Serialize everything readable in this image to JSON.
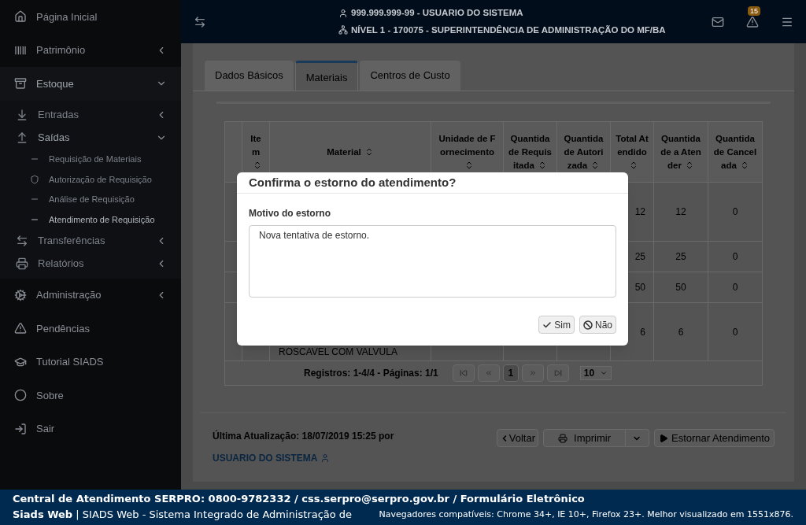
{
  "sidebar": {
    "items": [
      {
        "label": "Página Inicial",
        "kind": "link"
      },
      {
        "label": "Patrimônio",
        "kind": "group",
        "expanded": false
      },
      {
        "label": "Estoque",
        "kind": "group",
        "expanded": true,
        "children": [
          {
            "label": "Entradas",
            "kind": "group",
            "expanded": false
          },
          {
            "label": "Saídas",
            "kind": "group",
            "expanded": true,
            "children": [
              {
                "label": "Requisição de Materiais",
                "selected": false
              },
              {
                "label": "Autorização de Requisição",
                "selected": false
              },
              {
                "label": "Análise de Requisição",
                "selected": false
              },
              {
                "label": "Atendimento de Requisição",
                "selected": true
              }
            ]
          },
          {
            "label": "Transferências",
            "kind": "group",
            "expanded": false
          },
          {
            "label": "Relatórios",
            "kind": "group",
            "expanded": false
          }
        ]
      },
      {
        "label": "Administração",
        "kind": "group",
        "expanded": false
      },
      {
        "label": "Pendências",
        "kind": "link"
      },
      {
        "label": "Tutorial SIADS",
        "kind": "link"
      },
      {
        "label": "Sobre",
        "kind": "link"
      },
      {
        "label": "Sair",
        "kind": "link"
      }
    ]
  },
  "header": {
    "user": "999.999.999-99 - USUARIO DO SISTEMA",
    "unit": "NÍVEL 1 - 170075 - SUPERINTENDÊNCIA DE ADMINISTRAÇÃO DO MF/BA",
    "alerts_badge": "15"
  },
  "tabs": [
    {
      "label": "Dados Básicos",
      "selected": false
    },
    {
      "label": "Materiais",
      "selected": true
    },
    {
      "label": "Centros de Custo",
      "selected": false
    }
  ],
  "table": {
    "columns": [
      "Item",
      "Material",
      "Unidade de Fornecimento",
      "Quantidade Requisitada",
      "Quantidade Autorizada",
      "Total Atendido",
      "Quantidade a Atender",
      "Quantidade Cancelada"
    ],
    "rows": [
      {
        "total_atendido": "12",
        "quantidade_a_atender": "12",
        "quantidade_cancelada": "0"
      },
      {
        "total_atendido": "25",
        "quantidade_a_atender": "25",
        "quantidade_cancelada": "0"
      },
      {
        "total_atendido": "50",
        "quantidade_a_atender": "50",
        "quantidade_cancelada": "0"
      },
      {
        "material": "ROSCAVEL COM VALVULA",
        "total_atendido": "6",
        "quantidade_a_atender": "6",
        "quantidade_cancelada": "0"
      }
    ]
  },
  "pagination": {
    "summary": "Registros: 1-4/4 - Páginas: 1/1",
    "current_page": "1",
    "page_size": "10"
  },
  "last_update": {
    "text": "Última Atualização: 18/07/2019 15:25 por",
    "user_link": "USUARIO DO SISTEMA"
  },
  "actions": [
    "Voltar",
    "Imprimir",
    "Estornar Atendimento"
  ],
  "dialog": {
    "title": "Confirma o estorno do atendimento?",
    "field_label": "Motivo do estorno",
    "value": "Nova tentativa de estorno.",
    "buttons": [
      "Sim",
      "Não"
    ]
  },
  "footer": {
    "line1": "Central de Atendimento SERPRO: 0800-9782332 / css.serpro@serpro.gov.br / Formulário Eletrônico",
    "line2": "**Siads Web** | SIADS Web - Sistema Integrado de Administração de",
    "browsers": "Navegadores compatíveis: Chrome 34+, IE 10+, Firefox 23+. Melhor visualizado em 1551x876."
  }
}
